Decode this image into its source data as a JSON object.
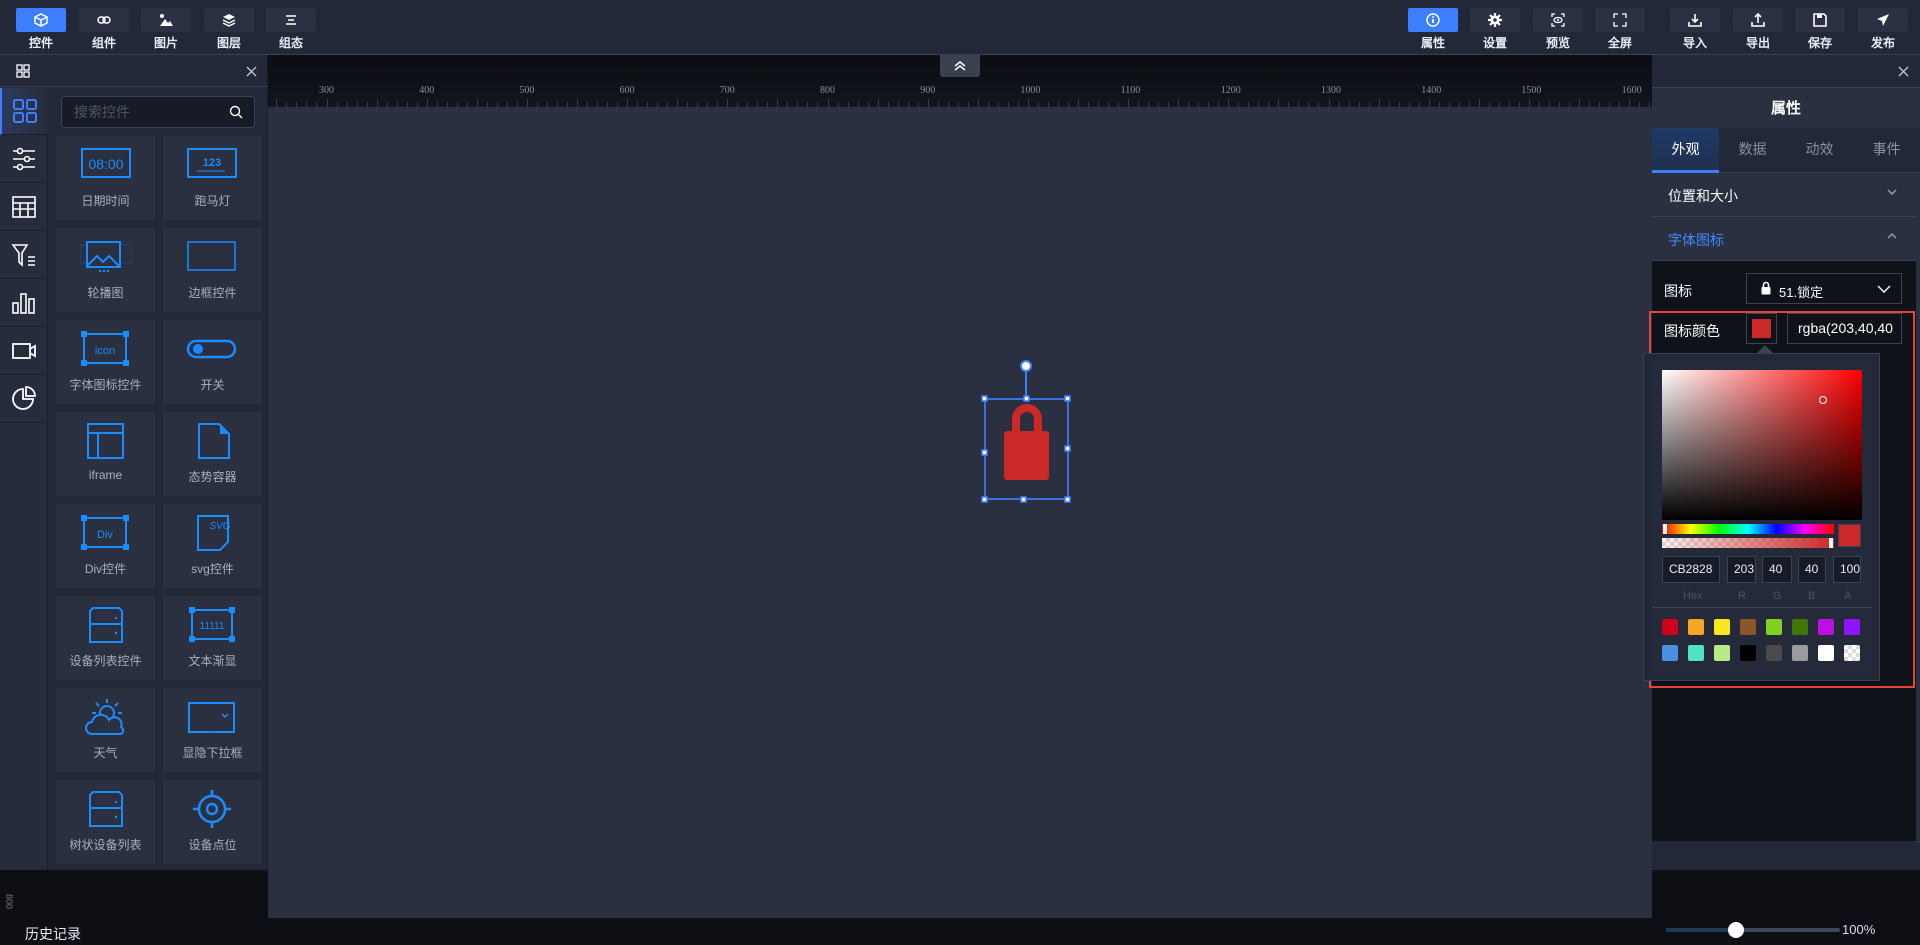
{
  "toolbar_left": [
    {
      "label": "控件",
      "icon": "cube-icon",
      "active": true
    },
    {
      "label": "组件",
      "icon": "link-icon"
    },
    {
      "label": "图片",
      "icon": "image-icon"
    },
    {
      "label": "图层",
      "icon": "layers-icon"
    },
    {
      "label": "组态",
      "icon": "align-icon"
    }
  ],
  "toolbar_right": [
    {
      "label": "属性",
      "icon": "info-icon",
      "active": true
    },
    {
      "label": "设置",
      "icon": "gear-icon"
    },
    {
      "label": "预览",
      "icon": "preview-icon"
    },
    {
      "label": "全屏",
      "icon": "fullscreen-icon"
    },
    {
      "label": "导入",
      "icon": "import-icon"
    },
    {
      "label": "导出",
      "icon": "export-icon"
    },
    {
      "label": "保存",
      "icon": "save-icon"
    },
    {
      "label": "发布",
      "icon": "publish-icon"
    }
  ],
  "ruler": {
    "labels": [
      "300",
      "400",
      "500",
      "600",
      "700",
      "800",
      "900",
      "1000",
      "1100",
      "1200",
      "1300",
      "1400",
      "1500",
      "1600"
    ],
    "vertical_label": "800"
  },
  "left_panel": {
    "search_placeholder": "搜索控件",
    "categories": [
      "widgets",
      "sliders",
      "table",
      "filter",
      "bar-chart",
      "video",
      "pie-chart"
    ],
    "widgets": [
      {
        "label": "日期时间",
        "icon": "datetime"
      },
      {
        "label": "跑马灯",
        "icon": "marquee"
      },
      {
        "label": "轮播图",
        "icon": "carousel"
      },
      {
        "label": "边框控件",
        "icon": "border"
      },
      {
        "label": "字体图标控件",
        "icon": "fonticon"
      },
      {
        "label": "开关",
        "icon": "switch"
      },
      {
        "label": "iframe",
        "icon": "iframe"
      },
      {
        "label": "态势容器",
        "icon": "file"
      },
      {
        "label": "Div控件",
        "icon": "div"
      },
      {
        "label": "svg控件",
        "icon": "svg"
      },
      {
        "label": "设备列表控件",
        "icon": "server"
      },
      {
        "label": "文本渐显",
        "icon": "text"
      },
      {
        "label": "天气",
        "icon": "weather"
      },
      {
        "label": "显隐下拉框",
        "icon": "dropdown"
      },
      {
        "label": "树状设备列表",
        "icon": "server"
      },
      {
        "label": "设备点位",
        "icon": "target"
      }
    ]
  },
  "right_panel": {
    "title": "属性",
    "tabs": [
      "外观",
      "数据",
      "动效",
      "事件"
    ],
    "sections": [
      "位置和大小",
      "字体图标"
    ],
    "icon_label": "图标",
    "icon_value": "51.锁定",
    "color_label": "图标颜色",
    "color_value": "rgba(203,40,40",
    "picker": {
      "hex": "CB2828",
      "r": "203",
      "g": "40",
      "b": "40",
      "a": "100",
      "labels": [
        "Hex",
        "R",
        "G",
        "B",
        "A"
      ],
      "swatches": [
        "#d0021b",
        "#f5a623",
        "#f8e71c",
        "#8b572a",
        "#7ed321",
        "#417505",
        "#bd10e0",
        "#9013fe",
        "#4a90e2",
        "#50e3c2",
        "#b8e986",
        "#000000",
        "#4a4a4a",
        "#9b9b9b",
        "#ffffff",
        "transparent"
      ]
    }
  },
  "canvas": {
    "selected_icon": "lock-icon",
    "icon_color": "#cb2828"
  },
  "footer": {
    "history_label": "历史记录",
    "zoom_label": "100%",
    "zoom_fraction": 0.4
  }
}
